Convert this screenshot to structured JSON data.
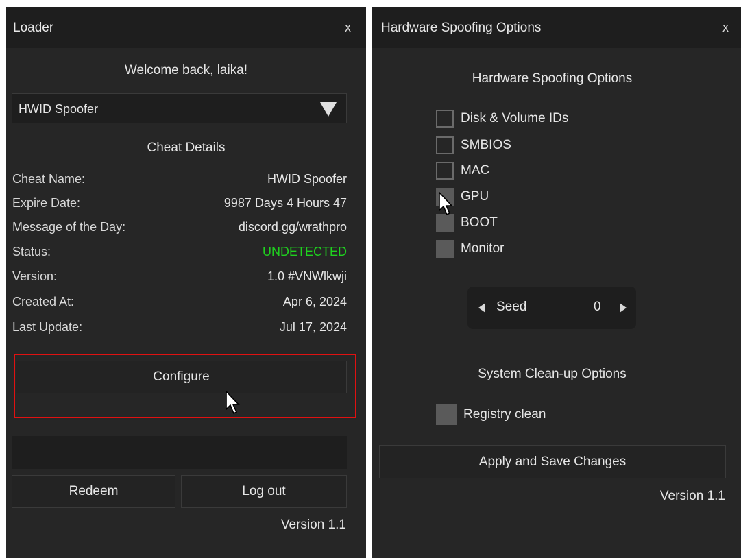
{
  "loader": {
    "title": "Loader",
    "close": "x",
    "welcome": "Welcome back, laika!",
    "dropdown_value": "HWID Spoofer",
    "details_heading": "Cheat Details",
    "details": [
      {
        "label": "Cheat Name:",
        "value": "HWID Spoofer"
      },
      {
        "label": "Expire Date:",
        "value": "9987 Days 4 Hours 47"
      },
      {
        "label": "Message of the Day:",
        "value": "discord.gg/wrathpro"
      },
      {
        "label": "Status:",
        "value": "UNDETECTED"
      },
      {
        "label": "Version:",
        "value": "1.0 #VNWlkwji"
      },
      {
        "label": "Created At:",
        "value": "Apr 6, 2024"
      },
      {
        "label": "Last Update:",
        "value": "Jul 17, 2024"
      }
    ],
    "configure_label": "Configure",
    "redeem_label": "Redeem",
    "logout_label": "Log out",
    "version": "Version 1.1",
    "status_color": "#1fd11f",
    "highlight_color": "#e01111"
  },
  "hw": {
    "title": "Hardware Spoofing Options",
    "close": "x",
    "heading": "Hardware Spoofing Options",
    "options": [
      {
        "label": "Disk & Volume IDs",
        "checked": false
      },
      {
        "label": "SMBIOS",
        "checked": false
      },
      {
        "label": "MAC",
        "checked": false
      },
      {
        "label": "GPU",
        "checked": true
      },
      {
        "label": "BOOT",
        "checked": true
      },
      {
        "label": "Monitor",
        "checked": true
      }
    ],
    "seed_label": "Seed",
    "seed_value": "0",
    "cleanup_heading": "System Clean-up Options",
    "cleanup_options": [
      {
        "label": "Registry clean",
        "checked": true
      }
    ],
    "apply_label": "Apply and Save Changes",
    "version": "Version 1.1"
  }
}
